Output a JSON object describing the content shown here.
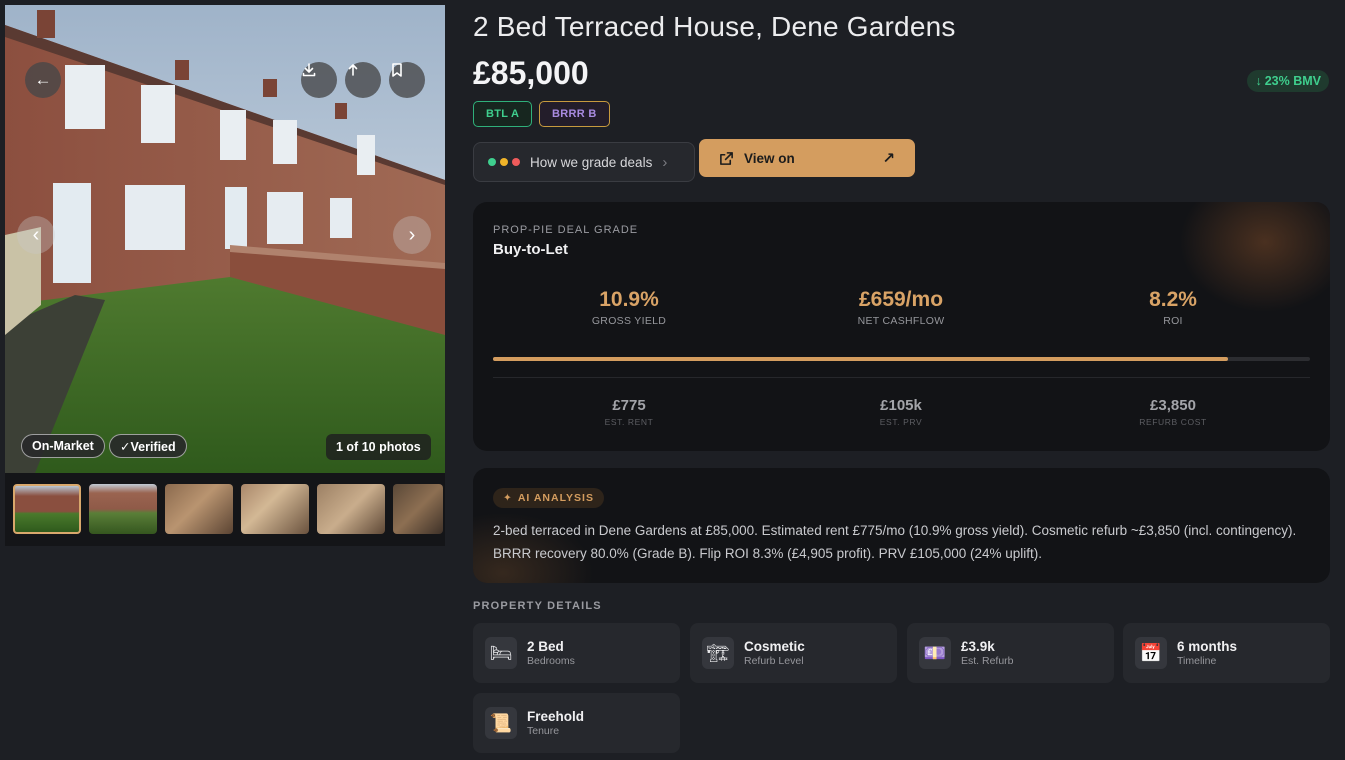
{
  "gallery": {
    "status_badges": [
      "On-Market",
      "✓Verified"
    ],
    "photo_count": "1 of 10 photos",
    "back_icon": "arrow-left-icon",
    "actions": [
      "download-icon",
      "share-icon",
      "bookmark-icon"
    ]
  },
  "listing": {
    "title": "2 Bed Terraced House, Dene Gardens",
    "price": "£85,000",
    "bmv": "23% BMV",
    "tags": [
      "BTL A",
      "BRRR B"
    ],
    "grade_button": "How we grade deals",
    "view_button": "View on"
  },
  "grade": {
    "eyebrow": "PROP-PIE DEAL GRADE",
    "strategy": "Buy-to-Let",
    "metrics": [
      {
        "value": "10.9%",
        "label": "GROSS YIELD"
      },
      {
        "value": "£659/mo",
        "label": "NET CASHFLOW"
      },
      {
        "value": "8.2%",
        "label": "ROI"
      }
    ],
    "progress_percent": 90,
    "sub_metrics": [
      {
        "value": "£775",
        "label": "EST. RENT"
      },
      {
        "value": "£105k",
        "label": "EST. PRV"
      },
      {
        "value": "£3,850",
        "label": "REFURB COST"
      }
    ]
  },
  "ai": {
    "badge": "AI ANALYSIS",
    "text": "2-bed terraced in Dene Gardens at £85,000. Estimated rent £775/mo (10.9% gross yield). Cosmetic refurb ~£3,850 (incl. contingency). BRRR recovery 80.0% (Grade B). Flip ROI 8.3% (£4,905 profit). PRV £105,000 (24% uplift)."
  },
  "details": {
    "label": "PROPERTY DETAILS",
    "items": [
      {
        "icon": "bed-icon",
        "glyph": "🛏",
        "value": "2 Bed",
        "label": "Bedrooms"
      },
      {
        "icon": "crane-icon",
        "glyph": "🏗",
        "value": "Cosmetic",
        "label": "Refurb Level"
      },
      {
        "icon": "money-icon",
        "glyph": "💷",
        "value": "£3.9k",
        "label": "Est. Refurb"
      },
      {
        "icon": "calendar-icon",
        "glyph": "📅",
        "value": "6 months",
        "label": "Timeline"
      },
      {
        "icon": "scroll-icon",
        "glyph": "📜",
        "value": "Freehold",
        "label": "Tenure"
      }
    ]
  },
  "colors": {
    "accent": "#d49d5f",
    "green": "#3fcf8e",
    "purple": "#a98be0",
    "background": "#1d1f24"
  }
}
